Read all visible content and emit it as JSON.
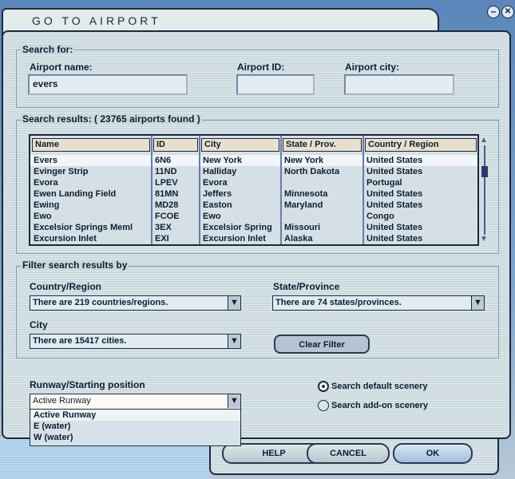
{
  "window": {
    "title": "GO TO AIRPORT",
    "minimize_icon": "minimize-icon",
    "close_icon": "close-icon"
  },
  "search": {
    "group_label": "Search for:",
    "name_label": "Airport name:",
    "name_value": "evers",
    "id_label": "Airport ID:",
    "id_value": "",
    "city_label": "Airport city:",
    "city_value": ""
  },
  "results": {
    "group_label": "Search results: ( 23765 airports found )",
    "columns": [
      "Name",
      "ID",
      "City",
      "State / Prov.",
      "Country / Region"
    ],
    "rows": [
      [
        "Evers",
        "6N6",
        "New York",
        "New York",
        "United States"
      ],
      [
        "Evinger Strip",
        "11ND",
        "Halliday",
        "North Dakota",
        "United States"
      ],
      [
        "Evora",
        "LPEV",
        "Evora",
        "",
        "Portugal"
      ],
      [
        "Ewen Landing Field",
        "81MN",
        "Jeffers",
        "Minnesota",
        "United States"
      ],
      [
        "Ewing",
        "MD28",
        "Easton",
        "Maryland",
        "United States"
      ],
      [
        "Ewo",
        "FCOE",
        "Ewo",
        "",
        "Congo"
      ],
      [
        "Excelsior Springs Meml",
        "3EX",
        "Excelsior Spring",
        "Missouri",
        "United States"
      ],
      [
        "Excursion Inlet",
        "EXI",
        "Excursion Inlet",
        "Alaska",
        "United States"
      ]
    ]
  },
  "filter": {
    "group_label": "Filter search results by",
    "country_label": "Country/Region",
    "country_value": "There are 219 countries/regions.",
    "state_label": "State/Province",
    "state_value": "There are 74 states/provinces.",
    "city_label": "City",
    "city_value": "There are 15417 cities.",
    "clear_label": "Clear Filter"
  },
  "runway": {
    "label": "Runway/Starting position",
    "value": "Active Runway",
    "options": [
      "Active Runway",
      "E (water)",
      "W (water)"
    ]
  },
  "scenery": {
    "default_label": "Search default scenery",
    "addon_label": "Search add-on scenery",
    "selected": "default"
  },
  "buttons": {
    "help": "HELP",
    "cancel": "CANCEL",
    "ok": "OK"
  }
}
